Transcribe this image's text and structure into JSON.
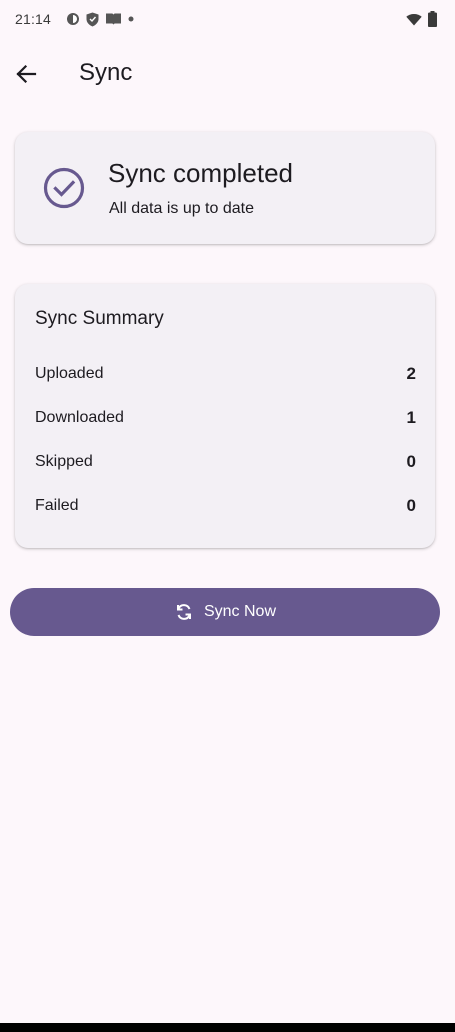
{
  "status_bar": {
    "time": "21:14",
    "left_icons": [
      "data-saver-icon",
      "shield-icon",
      "book-icon",
      "dot-icon"
    ],
    "right_icons": [
      "wifi-icon",
      "battery-icon"
    ]
  },
  "app_bar": {
    "back_icon": "arrow-back-icon",
    "title": "Sync"
  },
  "status_card": {
    "icon": "check-circle-icon",
    "title": "Sync completed",
    "subtitle": "All data is up to date"
  },
  "summary": {
    "title": "Sync Summary",
    "rows": [
      {
        "label": "Uploaded",
        "value": "2"
      },
      {
        "label": "Downloaded",
        "value": "1"
      },
      {
        "label": "Skipped",
        "value": "0"
      },
      {
        "label": "Failed",
        "value": "0"
      }
    ]
  },
  "sync_button": {
    "icon": "sync-icon",
    "label": "Sync Now"
  },
  "colors": {
    "background": "#fdf7fb",
    "card": "#f3f0f5",
    "primary": "#67598f",
    "text": "#1d1b20"
  }
}
